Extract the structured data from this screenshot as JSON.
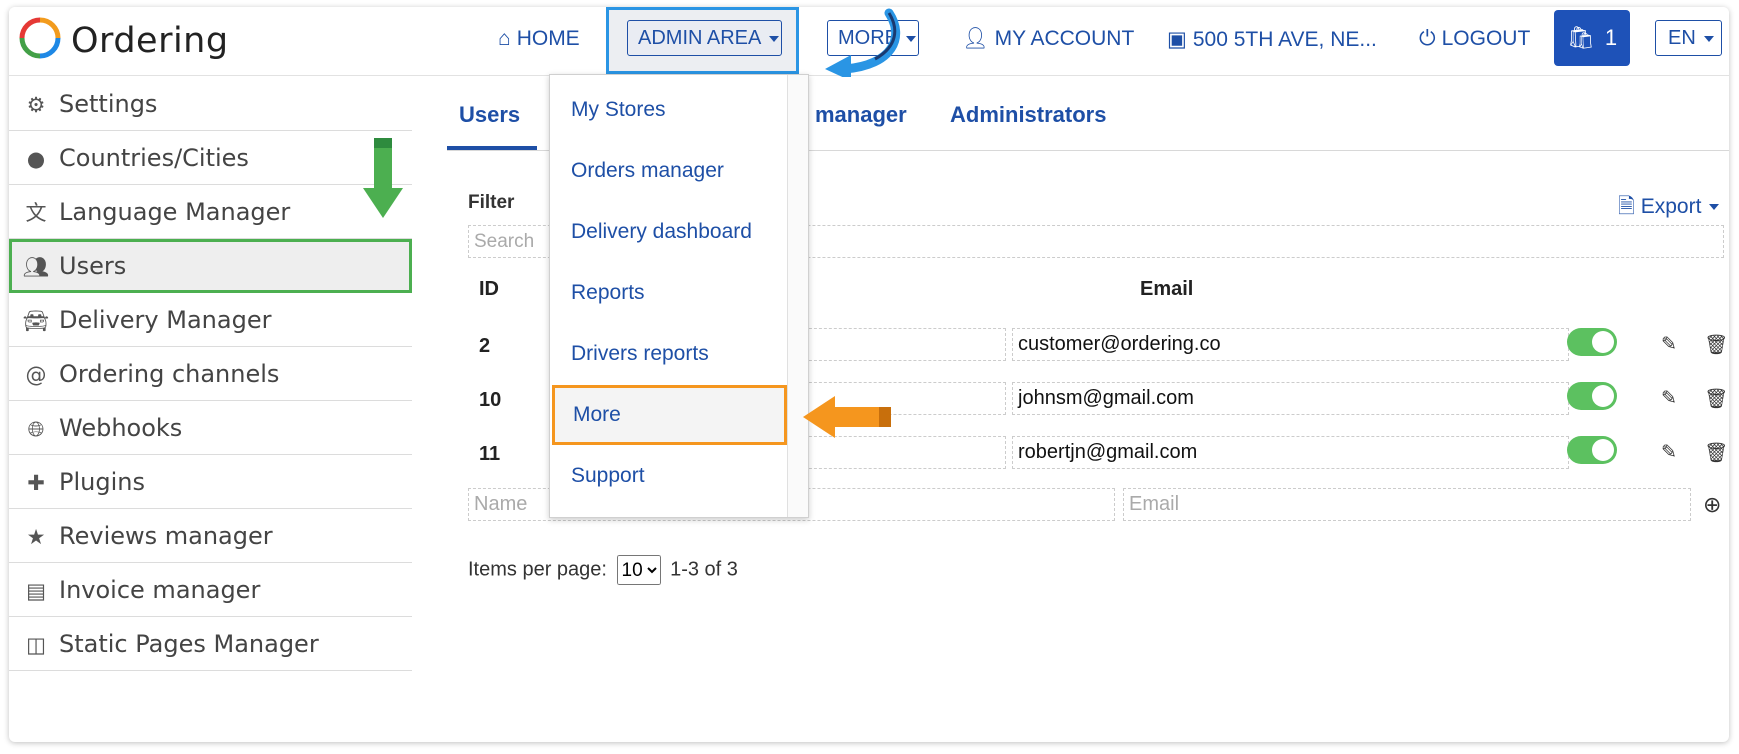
{
  "brand": "Ordering",
  "nav": {
    "home": "HOME",
    "admin_area": "ADMIN AREA",
    "more": "MORE",
    "my_account": "MY ACCOUNT",
    "address": "500 5TH AVE, NE...",
    "logout": "LOGOUT",
    "cart_count": "1",
    "language": "EN"
  },
  "sidebar": {
    "items": [
      {
        "label": "Settings",
        "icon": "gear-icon"
      },
      {
        "label": "Countries/Cities",
        "icon": "map-pin-icon"
      },
      {
        "label": "Language Manager",
        "icon": "translate-icon"
      },
      {
        "label": "Users",
        "icon": "users-icon",
        "active": true
      },
      {
        "label": "Delivery Manager",
        "icon": "car-icon"
      },
      {
        "label": "Ordering channels",
        "icon": "at-icon"
      },
      {
        "label": "Webhooks",
        "icon": "globe-icon"
      },
      {
        "label": "Plugins",
        "icon": "puzzle-icon"
      },
      {
        "label": "Reviews manager",
        "icon": "star-icon"
      },
      {
        "label": "Invoice manager",
        "icon": "document-icon"
      },
      {
        "label": "Static Pages Manager",
        "icon": "columns-icon"
      }
    ]
  },
  "tabs": {
    "users": "Users",
    "manager_partial": "manager",
    "administrators": "Administrators"
  },
  "filter": {
    "label": "Filter",
    "search_placeholder": "Search",
    "export": "Export"
  },
  "table": {
    "headers": {
      "id": "ID",
      "email": "Email"
    },
    "rows": [
      {
        "id": "2",
        "email": "customer@ordering.co",
        "enabled": true
      },
      {
        "id": "10",
        "email": "johnsm@gmail.com",
        "enabled": true
      },
      {
        "id": "11",
        "email": "robertjn@gmail.com",
        "enabled": true
      }
    ],
    "new_name_placeholder": "Name",
    "new_email_placeholder": "Email"
  },
  "pagination": {
    "items_per_page_label": "Items per page:",
    "items_per_page_value": "10",
    "range": "1-3 of 3"
  },
  "admin_dropdown": {
    "items": [
      "My Stores",
      "Orders manager",
      "Delivery dashboard",
      "Reports",
      "Drivers reports",
      "More",
      "Support"
    ],
    "highlighted": "More"
  },
  "colors": {
    "accent": "#1e4fa6",
    "cart": "#1e52b8",
    "toggle_on": "#5cc160",
    "highlight_green": "#4caf50",
    "highlight_orange": "#f5961e",
    "highlight_blue": "#2a95e4"
  }
}
